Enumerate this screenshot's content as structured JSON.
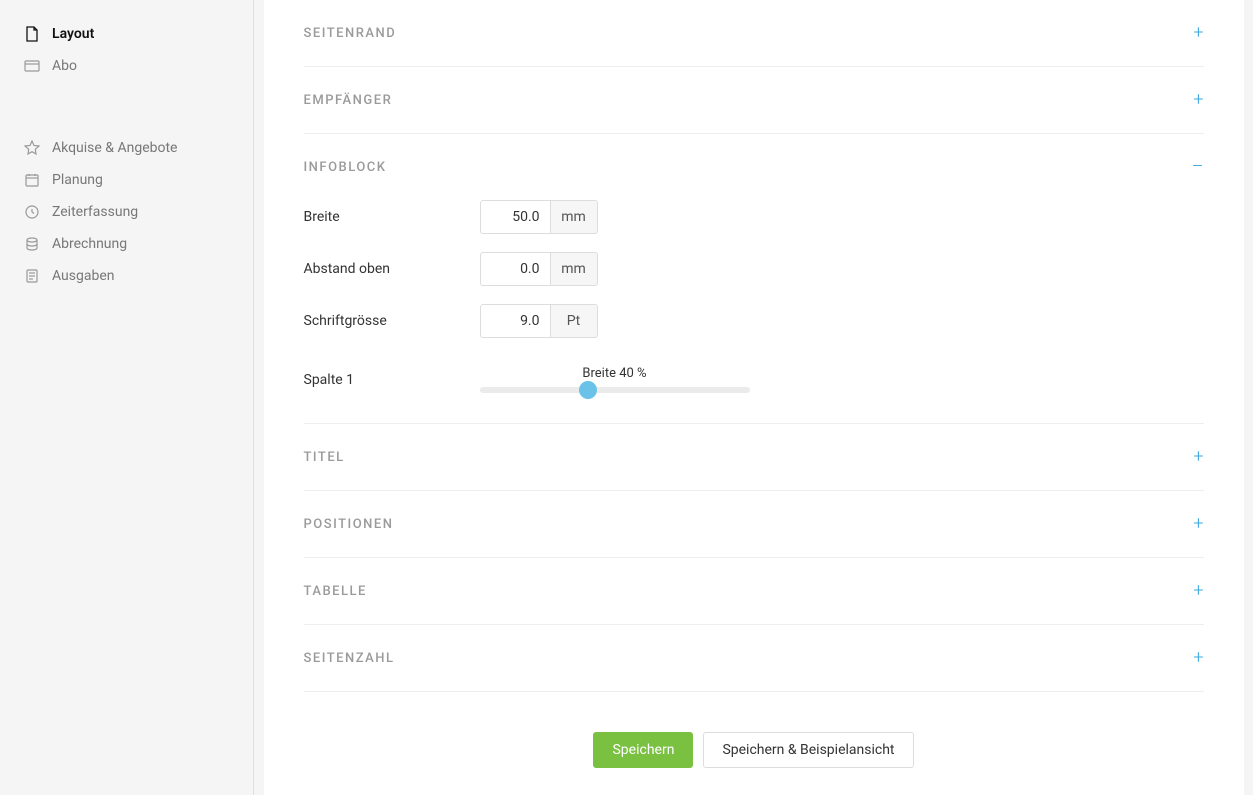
{
  "sidebar": {
    "group1": [
      {
        "label": "Layout",
        "icon": "file-icon",
        "active": true
      },
      {
        "label": "Abo",
        "icon": "card-icon",
        "active": false
      }
    ],
    "group2": [
      {
        "label": "Akquise & Angebote",
        "icon": "star-icon"
      },
      {
        "label": "Planung",
        "icon": "calendar-icon"
      },
      {
        "label": "Zeiterfassung",
        "icon": "clock-icon"
      },
      {
        "label": "Abrechnung",
        "icon": "stack-icon"
      },
      {
        "label": "Ausgaben",
        "icon": "receipt-icon"
      }
    ]
  },
  "sections": {
    "seitenrand": {
      "title": "Seitenrand",
      "expanded": false
    },
    "empfaenger": {
      "title": "Empfänger",
      "expanded": false
    },
    "infoblock": {
      "title": "Infoblock",
      "expanded": true,
      "fields": {
        "breite": {
          "label": "Breite",
          "value": "50.0",
          "unit": "mm"
        },
        "abstand_oben": {
          "label": "Abstand oben",
          "value": "0.0",
          "unit": "mm"
        },
        "schriftgroesse": {
          "label": "Schriftgrösse",
          "value": "9.0",
          "unit": "Pt"
        },
        "spalte1": {
          "label": "Spalte 1",
          "slider_label": "Breite 40 %",
          "percent": 40
        }
      }
    },
    "titel": {
      "title": "Titel",
      "expanded": false
    },
    "positionen": {
      "title": "Positionen",
      "expanded": false
    },
    "tabelle": {
      "title": "Tabelle",
      "expanded": false
    },
    "seitenzahl": {
      "title": "Seitenzahl",
      "expanded": false
    }
  },
  "buttons": {
    "save": "Speichern",
    "save_preview": "Speichern & Beispielansicht"
  }
}
